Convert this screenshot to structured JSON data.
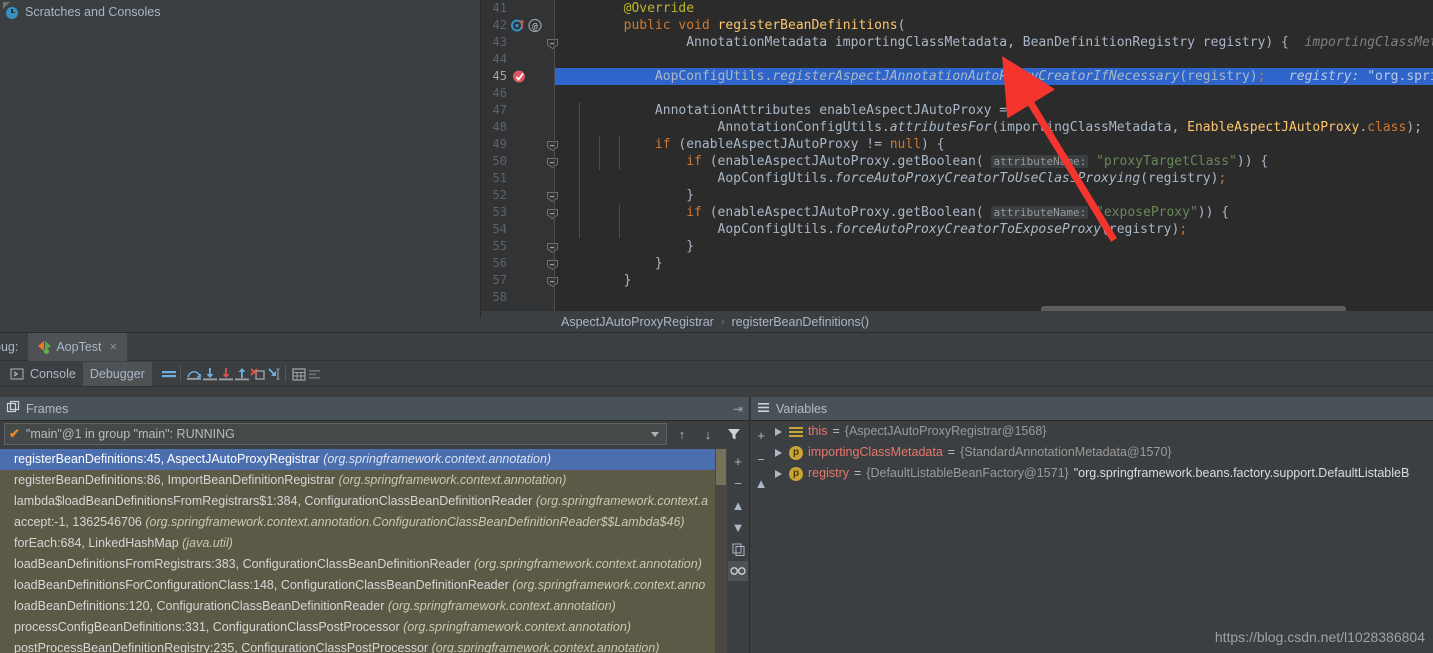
{
  "project": {
    "scratches_label": "Scratches and Consoles",
    "scratches_icon": "scratch-clock-icon"
  },
  "editor": {
    "first_line": 41,
    "current_line": 45,
    "lines": [
      {
        "n": 41,
        "tokens": [
          {
            "t": "        ",
            "c": ""
          },
          {
            "t": "@Override",
            "c": "anno"
          }
        ]
      },
      {
        "n": 42,
        "gutter": "override-marker,annotation-marker",
        "tokens": [
          {
            "t": "        ",
            "c": ""
          },
          {
            "t": "public",
            "c": "kw"
          },
          {
            "t": " ",
            "c": ""
          },
          {
            "t": "void",
            "c": "kw"
          },
          {
            "t": " ",
            "c": ""
          },
          {
            "t": "registerBeanDefinitions",
            "c": "mth"
          },
          {
            "t": "(",
            "c": ""
          }
        ]
      },
      {
        "n": 43,
        "fold": true,
        "tokens": [
          {
            "t": "                AnnotationMetadata importingClassMetadata, BeanDefinitionRegistry registry) {  ",
            "c": ""
          },
          {
            "t": "importingClassMeta",
            "c": "hint"
          }
        ]
      },
      {
        "n": 44,
        "tokens": []
      },
      {
        "n": 45,
        "highlight": true,
        "gutter": "breakpoint-verified",
        "tokens": [
          {
            "t": "            ",
            "c": ""
          },
          {
            "t": "AopConfigUtils",
            "c": ""
          },
          {
            "t": ".",
            "c": ""
          },
          {
            "t": "registerAspectJAnnotationAutoProxyCreatorIfNecessary",
            "c": "itl"
          },
          {
            "t": "(registry)",
            "c": ""
          },
          {
            "t": ";",
            "c": "kw"
          },
          {
            "t": "   ",
            "c": ""
          },
          {
            "t": "registry: ",
            "c": "hint"
          },
          {
            "t": "\"org.spring",
            "c": "st"
          }
        ]
      },
      {
        "n": 46,
        "tokens": []
      },
      {
        "n": 47,
        "tokens": [
          {
            "t": "            AnnotationAttributes enableAspectJAutoProxy =",
            "c": ""
          }
        ]
      },
      {
        "n": 48,
        "tokens": [
          {
            "t": "                    AnnotationConfigUtils",
            "c": ""
          },
          {
            "t": ".",
            "c": ""
          },
          {
            "t": "attributesFor",
            "c": "itl"
          },
          {
            "t": "(importingClassMetadata, ",
            "c": ""
          },
          {
            "t": "EnableAspectJAutoProxy",
            "c": "mth"
          },
          {
            "t": ".",
            "c": ""
          },
          {
            "t": "class",
            "c": "kw"
          },
          {
            "t": ");",
            "c": ""
          }
        ]
      },
      {
        "n": 49,
        "fold": true,
        "tokens": [
          {
            "t": "            ",
            "c": ""
          },
          {
            "t": "if",
            "c": "kw"
          },
          {
            "t": " (enableAspectJAutoProxy != ",
            "c": ""
          },
          {
            "t": "null",
            "c": "kw"
          },
          {
            "t": ") {",
            "c": ""
          }
        ]
      },
      {
        "n": 50,
        "fold": true,
        "tokens": [
          {
            "t": "                ",
            "c": ""
          },
          {
            "t": "if",
            "c": "kw"
          },
          {
            "t": " (enableAspectJAutoProxy.getBoolean( ",
            "c": ""
          },
          {
            "t": "attributeName:",
            "c": "hintbox"
          },
          {
            "t": " ",
            "c": ""
          },
          {
            "t": "\"proxyTargetClass\"",
            "c": "st"
          },
          {
            "t": ")) {",
            "c": ""
          }
        ]
      },
      {
        "n": 51,
        "tokens": [
          {
            "t": "                    AopConfigUtils",
            "c": ""
          },
          {
            "t": ".",
            "c": ""
          },
          {
            "t": "forceAutoProxyCreatorToUseClassProxying",
            "c": "itl"
          },
          {
            "t": "(registry)",
            "c": ""
          },
          {
            "t": ";",
            "c": "kw"
          }
        ]
      },
      {
        "n": 52,
        "fold": true,
        "tokens": [
          {
            "t": "                }",
            "c": ""
          }
        ]
      },
      {
        "n": 53,
        "fold": true,
        "tokens": [
          {
            "t": "                ",
            "c": ""
          },
          {
            "t": "if",
            "c": "kw"
          },
          {
            "t": " (enableAspectJAutoProxy.getBoolean( ",
            "c": ""
          },
          {
            "t": "attributeName:",
            "c": "hintbox"
          },
          {
            "t": " ",
            "c": ""
          },
          {
            "t": "\"exposeProxy\"",
            "c": "st"
          },
          {
            "t": ")) {",
            "c": ""
          }
        ]
      },
      {
        "n": 54,
        "tokens": [
          {
            "t": "                    AopConfigUtils",
            "c": ""
          },
          {
            "t": ".",
            "c": ""
          },
          {
            "t": "forceAutoProxyCreatorToExposeProxy",
            "c": "itl"
          },
          {
            "t": "(registry)",
            "c": ""
          },
          {
            "t": ";",
            "c": "kw"
          }
        ]
      },
      {
        "n": 55,
        "fold": true,
        "tokens": [
          {
            "t": "                }",
            "c": ""
          }
        ]
      },
      {
        "n": 56,
        "fold": true,
        "tokens": [
          {
            "t": "            }",
            "c": ""
          }
        ]
      },
      {
        "n": 57,
        "fold": true,
        "tokens": [
          {
            "t": "        }",
            "c": ""
          }
        ]
      },
      {
        "n": 58,
        "tokens": []
      }
    ]
  },
  "breadcrumb": {
    "class": "AspectJAutoProxyRegistrar",
    "separator": "›",
    "method": "registerBeanDefinitions()"
  },
  "debug_window": {
    "title": "bug:",
    "tab": {
      "label": "AopTest",
      "close": "×",
      "icon": "run-config-icon"
    },
    "toolbar": {
      "console_label": "Console",
      "debugger_label": "Debugger",
      "buttons": [
        {
          "name": "mute-breakpoints-icon",
          "title": "Mute Breakpoints"
        },
        {
          "name": "step-over-icon",
          "title": "Step Over"
        },
        {
          "name": "step-into-icon",
          "title": "Step Into"
        },
        {
          "name": "force-step-into-icon",
          "title": "Force Step Into"
        },
        {
          "name": "step-out-icon",
          "title": "Step Out"
        },
        {
          "name": "drop-frame-icon",
          "title": "Drop Frame"
        },
        {
          "name": "run-to-cursor-icon",
          "title": "Run to Cursor"
        },
        {
          "name": "evaluate-expression-icon",
          "title": "Evaluate Expression"
        },
        {
          "name": "settings-icon",
          "title": "Layout Settings"
        }
      ]
    }
  },
  "frames": {
    "header": "Frames",
    "header_icon": "frames-icon",
    "thread": "\"main\"@1 in group \"main\": RUNNING",
    "thread_status_icon": "check-icon",
    "controls": [
      "arrow-up",
      "arrow-down",
      "filter-icon"
    ],
    "sidebar_icons": [
      "add-icon",
      "remove-icon",
      "move-up-icon",
      "move-down-icon",
      "copy-icon",
      "glasses-icon"
    ],
    "items": [
      {
        "method": "registerBeanDefinitions:45, AspectJAutoProxyRegistrar",
        "pkg": "(org.springframework.context.annotation)",
        "selected": true
      },
      {
        "method": "registerBeanDefinitions:86, ImportBeanDefinitionRegistrar",
        "pkg": "(org.springframework.context.annotation)",
        "selected": false
      },
      {
        "method": "lambda$loadBeanDefinitionsFromRegistrars$1:384, ConfigurationClassBeanDefinitionReader",
        "pkg": "(org.springframework.context.a",
        "selected": false
      },
      {
        "method": "accept:-1, 1362546706",
        "pkg": "(org.springframework.context.annotation.ConfigurationClassBeanDefinitionReader$$Lambda$46)",
        "selected": false
      },
      {
        "method": "forEach:684, LinkedHashMap",
        "pkg": "(java.util)",
        "selected": false
      },
      {
        "method": "loadBeanDefinitionsFromRegistrars:383, ConfigurationClassBeanDefinitionReader",
        "pkg": "(org.springframework.context.annotation)",
        "selected": false
      },
      {
        "method": "loadBeanDefinitionsForConfigurationClass:148, ConfigurationClassBeanDefinitionReader",
        "pkg": "(org.springframework.context.anno",
        "selected": false
      },
      {
        "method": "loadBeanDefinitions:120, ConfigurationClassBeanDefinitionReader",
        "pkg": "(org.springframework.context.annotation)",
        "selected": false
      },
      {
        "method": "processConfigBeanDefinitions:331, ConfigurationClassPostProcessor",
        "pkg": "(org.springframework.context.annotation)",
        "selected": false
      },
      {
        "method": "postProcessBeanDefinitionRegistry:235, ConfigurationClassPostProcessor",
        "pkg": "(org.springframework.context.annotation)",
        "selected": false
      }
    ]
  },
  "variables": {
    "header": "Variables",
    "header_icon": "variables-icon",
    "items": [
      {
        "icon": "this-icon",
        "name": "this",
        "eq": "=",
        "value": "{AspectJAutoProxyRegistrar@1568}",
        "extra": ""
      },
      {
        "icon": "param-icon",
        "name": "importingClassMetadata",
        "eq": "=",
        "value": "{StandardAnnotationMetadata@1570}",
        "extra": ""
      },
      {
        "icon": "param-icon",
        "name": "registry",
        "eq": "=",
        "value": "{DefaultListableBeanFactory@1571}",
        "extra": "\"org.springframework.beans.factory.support.DefaultListableB"
      }
    ]
  },
  "watermark": "https://blog.csdn.net/l1028386804",
  "colors": {
    "editor_bg": "#2b2b2b",
    "gutter_bg": "#313335",
    "ui_bg": "#3c3f41",
    "selection": "#2f65ca",
    "frames_bg": "#5c5a46",
    "frame_selected": "#4b6eaf",
    "panel_header": "#4a5259",
    "accent_red": "#e8766b",
    "arrow_red": "#f4352d"
  }
}
